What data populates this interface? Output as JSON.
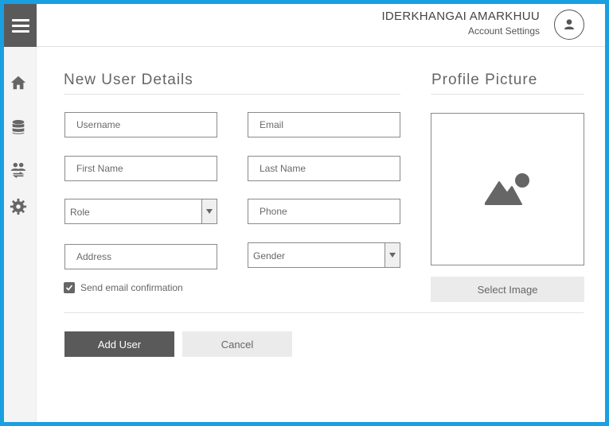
{
  "header": {
    "user_name": "IDERKHANGAI AMARKHUU",
    "account_settings": "Account Settings"
  },
  "sidebar": {
    "items": [
      {
        "icon": "home-icon"
      },
      {
        "icon": "database-icon"
      },
      {
        "icon": "users-transfer-icon"
      },
      {
        "icon": "gear-icon"
      }
    ]
  },
  "form": {
    "title": "New User Details",
    "username_placeholder": "Username",
    "email_placeholder": "Email",
    "first_name_placeholder": "First Name",
    "last_name_placeholder": "Last Name",
    "role_label": "Role",
    "phone_placeholder": "Phone",
    "address_placeholder": "Address",
    "gender_label": "Gender",
    "send_email_label": "Send email confirmation",
    "send_email_checked": true,
    "add_user_label": "Add User",
    "cancel_label": "Cancel"
  },
  "profile": {
    "title": "Profile Picture",
    "select_image_label": "Select Image",
    "placeholder_icon": "image-icon"
  },
  "colors": {
    "accent_border": "#1a9fe0",
    "dark": "#5a5a5a",
    "light_button": "#ebebeb"
  }
}
